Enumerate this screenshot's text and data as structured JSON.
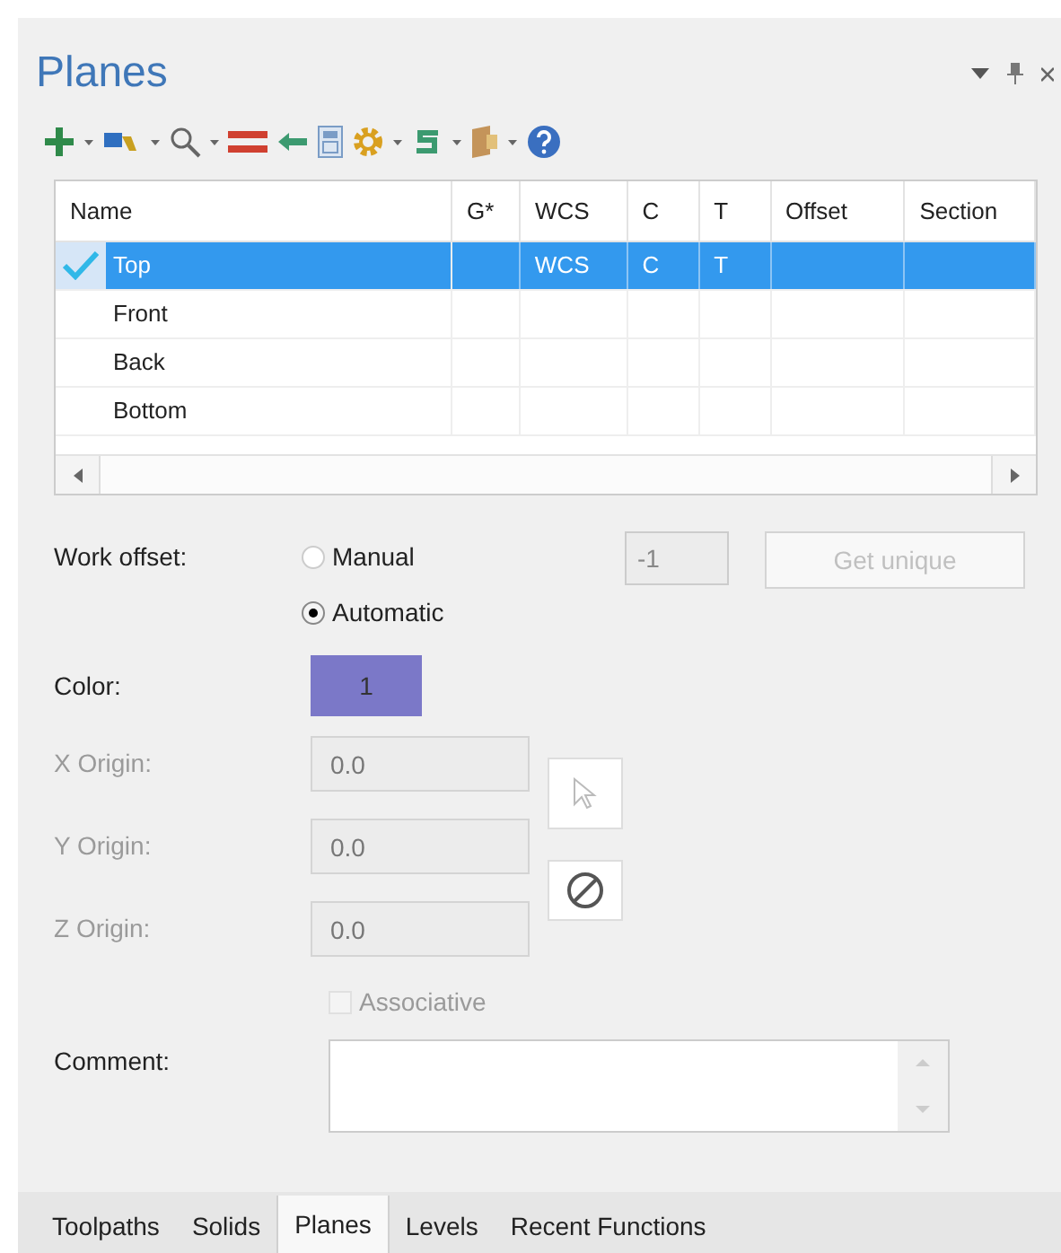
{
  "panel": {
    "title": "Planes"
  },
  "table": {
    "columns": [
      "Name",
      "G*",
      "WCS",
      "C",
      "T",
      "Offset",
      "Section"
    ],
    "rows": [
      {
        "cells": [
          "Top",
          "",
          "WCS",
          "C",
          "T",
          "",
          ""
        ],
        "selected": true,
        "checked": true
      },
      {
        "cells": [
          "Front",
          "",
          "",
          "",
          "",
          "",
          ""
        ],
        "selected": false,
        "checked": false
      },
      {
        "cells": [
          "Back",
          "",
          "",
          "",
          "",
          "",
          ""
        ],
        "selected": false,
        "checked": false
      },
      {
        "cells": [
          "Bottom",
          "",
          "",
          "",
          "",
          "",
          ""
        ],
        "selected": false,
        "checked": false
      }
    ]
  },
  "work_offset": {
    "label": "Work offset:",
    "options": [
      {
        "label": "Manual",
        "selected": false
      },
      {
        "label": "Automatic",
        "selected": true
      }
    ],
    "value": "-1",
    "button": "Get unique"
  },
  "color": {
    "label": "Color:",
    "value": "1",
    "color": "#7b78c8"
  },
  "origins": [
    {
      "label": "X Origin:",
      "value": "0.0"
    },
    {
      "label": "Y Origin:",
      "value": "0.0"
    },
    {
      "label": "Z Origin:",
      "value": "0.0"
    }
  ],
  "associative": {
    "label": "Associative",
    "checked": false,
    "disabled": true
  },
  "comment": {
    "label": "Comment:"
  },
  "tabs": [
    {
      "label": "Toolpaths",
      "selected": false
    },
    {
      "label": "Solids",
      "selected": false
    },
    {
      "label": "Planes",
      "selected": true
    },
    {
      "label": "Levels",
      "selected": false
    },
    {
      "label": "Recent Functions",
      "selected": false
    }
  ]
}
